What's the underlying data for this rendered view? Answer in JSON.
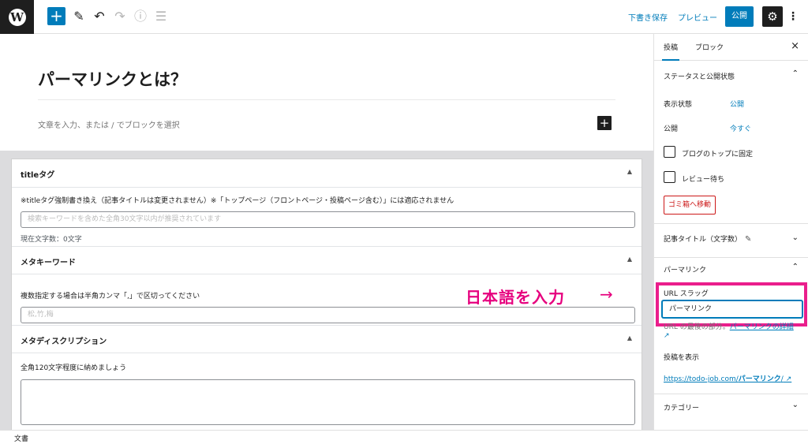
{
  "toolbar": {
    "logo_glyph": "W",
    "add_glyph": "+",
    "draft_save": "下書き保存",
    "preview": "プレビュー",
    "publish": "公開"
  },
  "post": {
    "title": "パーマリンクとは？",
    "body_placeholder": "文章を入力、または / でブロックを選択"
  },
  "metaboxes": {
    "title_tag": {
      "heading": "titleタグ",
      "description": "※titleタグ強制書き換え（記事タイトルは変更されません）※「トップページ（フロントページ・投稿ページ含む）」には適応されません",
      "placeholder": "検索キーワードを含めた全角30文字以内が推奨されています",
      "count_note": "現在文字数：0文字"
    },
    "meta_keywords": {
      "heading": "メタキーワード",
      "description": "複数指定する場合は半角カンマ「,」で区切ってください",
      "placeholder": "松,竹,梅"
    },
    "meta_description": {
      "heading": "メタディスクリプション",
      "description": "全角120文字程度に納めましょう"
    }
  },
  "annotation": {
    "text": "日本語を入力",
    "arrow": "→",
    "color": "#e6007e"
  },
  "statusbar": {
    "label": "文書"
  },
  "sidebar": {
    "tabs": [
      "投稿",
      "ブロック"
    ],
    "status_panel": {
      "title": "ステータスと公開状態",
      "visibility_label": "表示状態",
      "visibility_value": "公開",
      "publish_label": "公開",
      "publish_value": "今すぐ",
      "sticky_label": "ブログのトップに固定",
      "pending_label": "レビュー待ち",
      "trash_label": "ゴミ箱へ移動"
    },
    "title_count_panel": "記事タイトル（文字数）",
    "permalink_panel": {
      "title": "パーマリンク",
      "slug_label": "URL スラッグ",
      "slug_value": "パーマリンク",
      "help_prefix": "URL の最後の部分。",
      "help_link": "パーマリンクの詳細",
      "view_label": "投稿を表示",
      "url_prefix": "https://todo-job.com/",
      "url_slug": "パーマリンク",
      "url_suffix": "/"
    },
    "category_panel": "カテゴリー"
  },
  "colors": {
    "accent": "#007cba",
    "highlight": "#ea1e8c",
    "danger": "#cc1818"
  }
}
